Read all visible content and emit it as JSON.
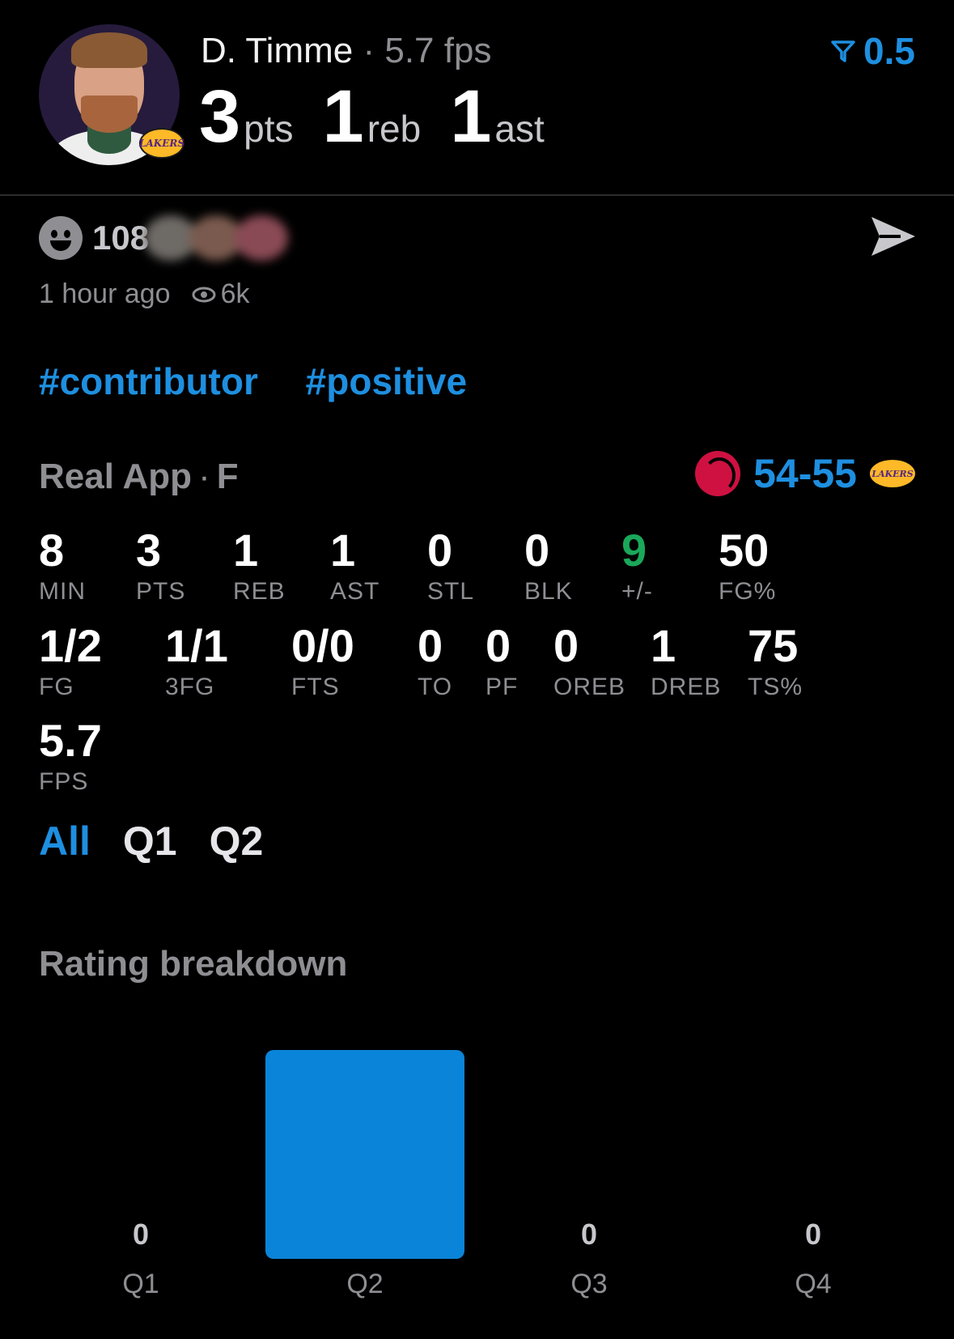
{
  "header": {
    "player_name": "D. Timme",
    "separator": "·",
    "fps_label": "5.7 fps",
    "pts_value": "3",
    "pts_unit": "pts",
    "reb_value": "1",
    "reb_unit": "reb",
    "ast_value": "1",
    "ast_unit": "ast",
    "team_badge_text": "LAKERS",
    "filter_value": "0.5"
  },
  "post": {
    "reaction_count": "108",
    "timestamp": "1 hour ago",
    "views": "6k",
    "tags": [
      "#contributor",
      "#positive"
    ]
  },
  "game": {
    "title": "Real App",
    "dot": "·",
    "position": "F",
    "score": "54-55",
    "home_badge_text": "LAKERS"
  },
  "stats": [
    {
      "value": "8",
      "label": "MIN"
    },
    {
      "value": "3",
      "label": "PTS"
    },
    {
      "value": "1",
      "label": "REB"
    },
    {
      "value": "1",
      "label": "AST"
    },
    {
      "value": "0",
      "label": "STL"
    },
    {
      "value": "0",
      "label": "BLK"
    },
    {
      "value": "9",
      "label": "+/-"
    },
    {
      "value": "50",
      "label": "FG%"
    },
    {
      "value": "1/2",
      "label": "FG"
    },
    {
      "value": "1/1",
      "label": "3FG"
    },
    {
      "value": "0/0",
      "label": "FTS"
    },
    {
      "value": "0",
      "label": "TO"
    },
    {
      "value": "0",
      "label": "PF"
    },
    {
      "value": "0",
      "label": "OREB"
    },
    {
      "value": "1",
      "label": "DREB"
    },
    {
      "value": "75",
      "label": "TS%"
    },
    {
      "value": "5.7",
      "label": "FPS"
    }
  ],
  "period_tabs": [
    "All",
    "Q1",
    "Q2"
  ],
  "chart_section": {
    "title": "Rating breakdown"
  },
  "colors": {
    "accent": "#1e8fe0",
    "positive": "#1aa85a",
    "muted": "#8e8e93",
    "bar": "#0a84d8"
  },
  "chart_data": {
    "type": "bar",
    "title": "Rating breakdown",
    "categories": [
      "Q1",
      "Q2",
      "Q3",
      "Q4"
    ],
    "values": [
      0,
      5.7,
      0,
      0
    ],
    "value_labels": [
      "0",
      "",
      "0",
      "0"
    ],
    "ylim": [
      0,
      5.7
    ],
    "grid": false
  }
}
